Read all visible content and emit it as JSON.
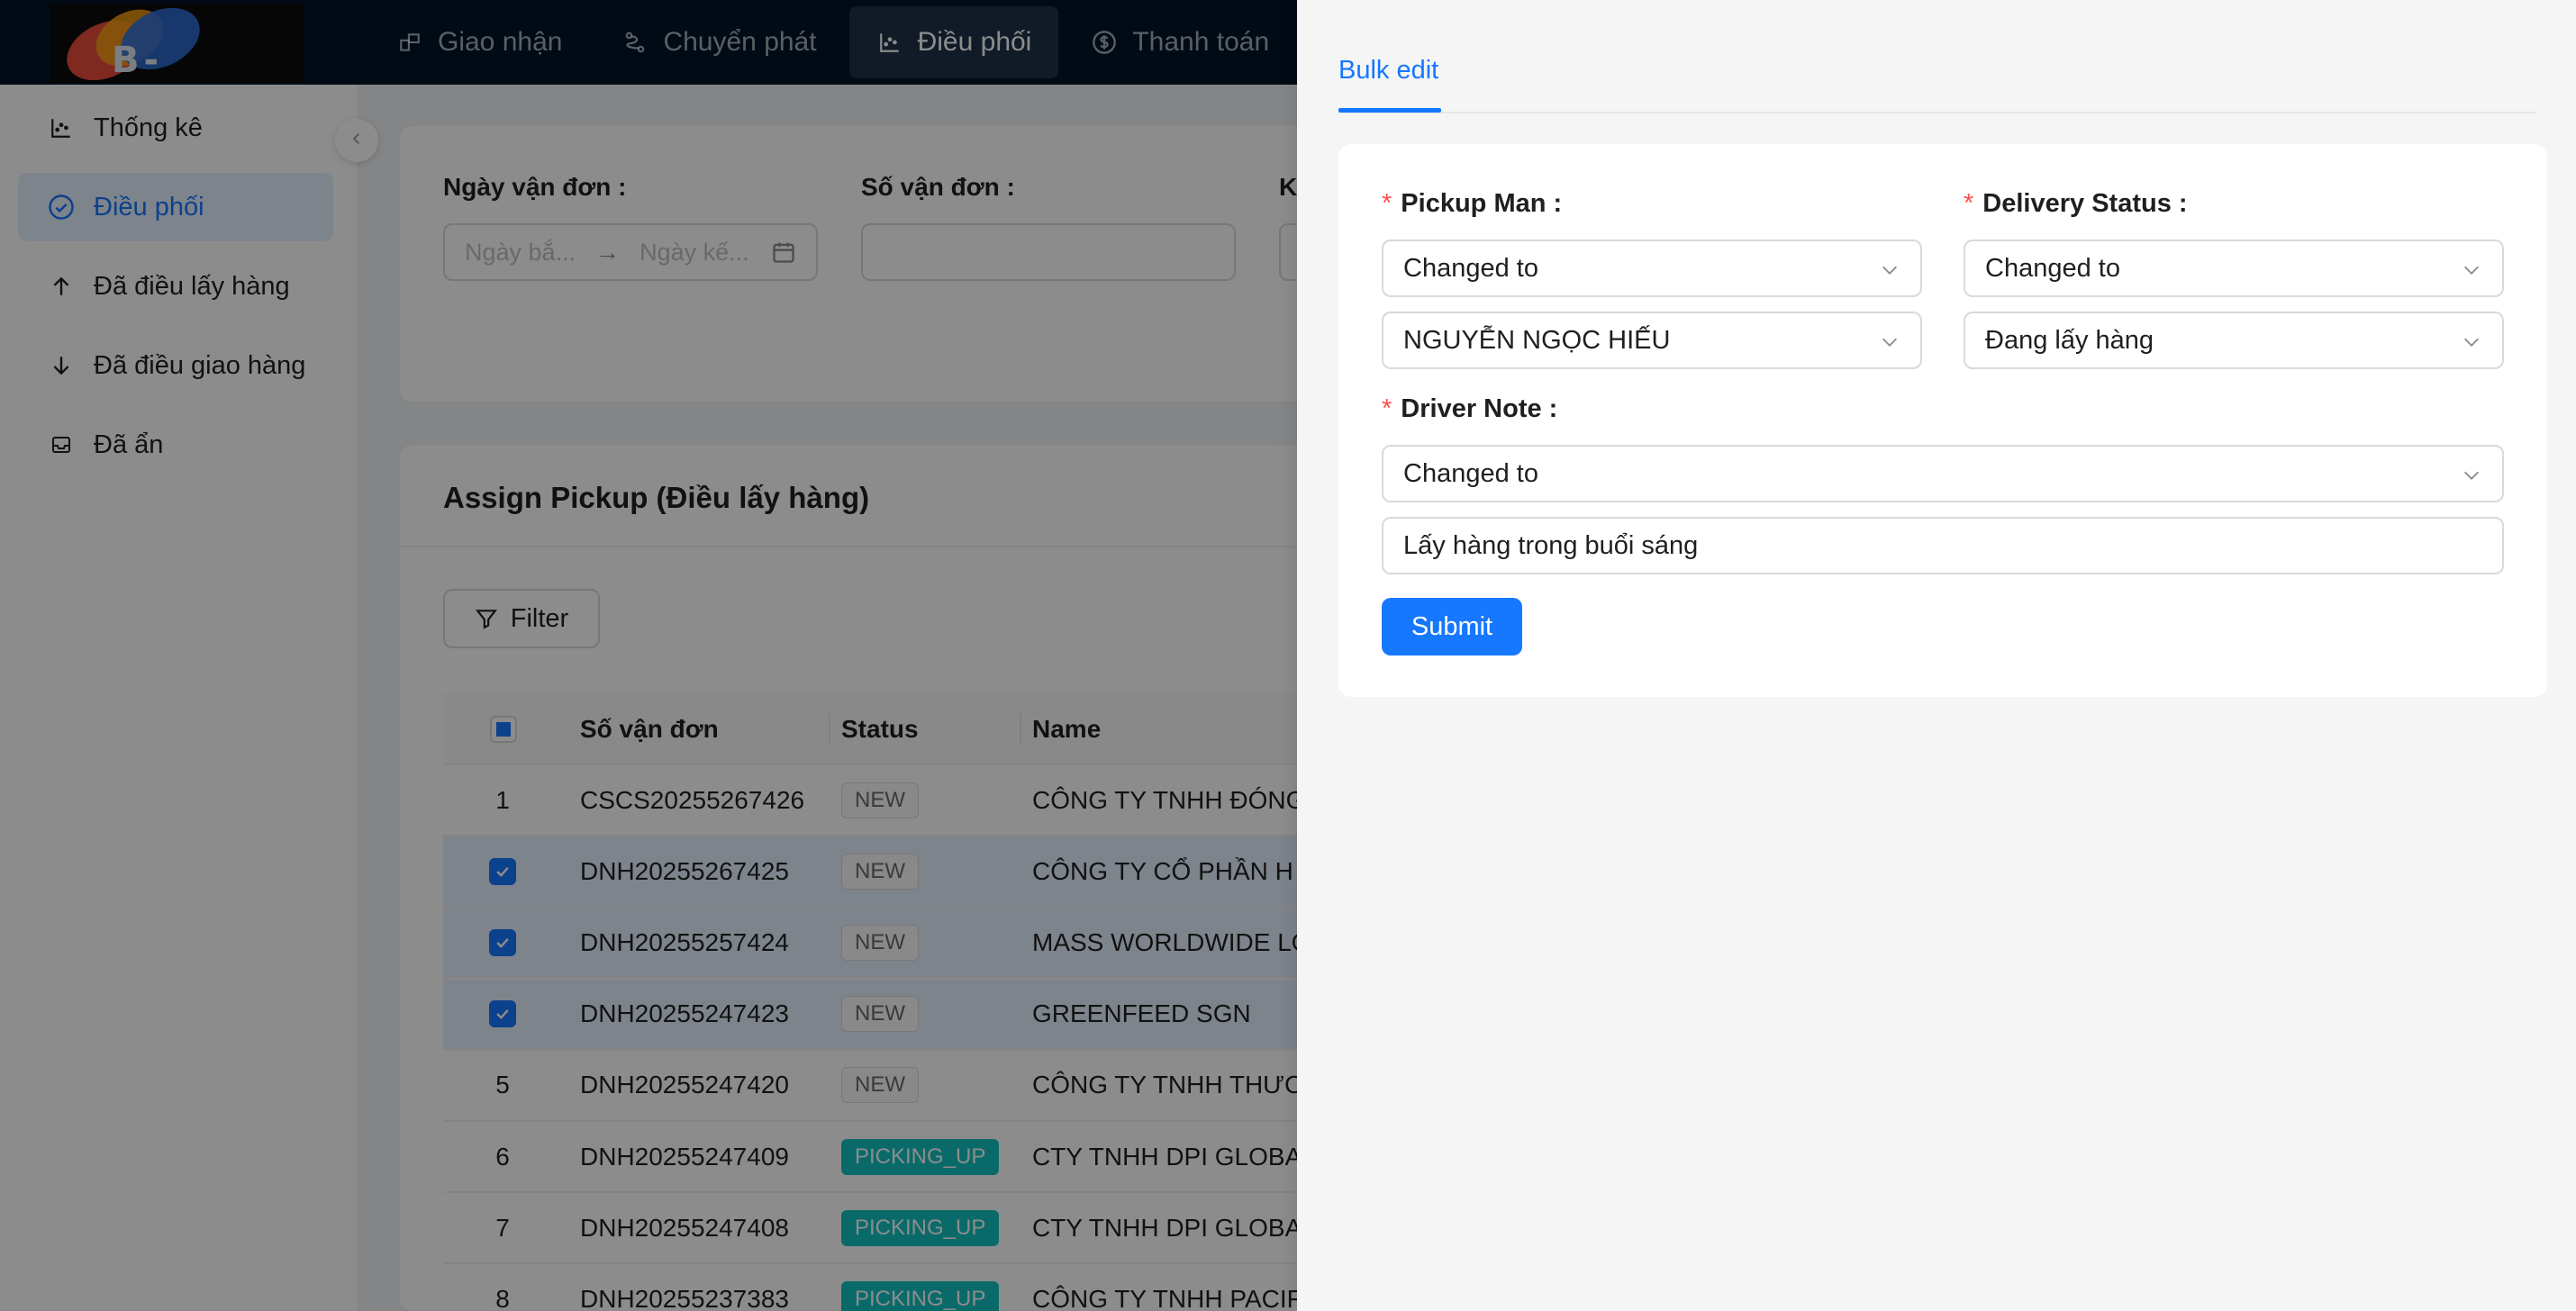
{
  "brand": {
    "logo_text": "B-LOGIS"
  },
  "topnav": {
    "items": [
      {
        "label": "Giao nhận",
        "icon": "box-icon"
      },
      {
        "label": "Chuyển phát",
        "icon": "route-icon"
      },
      {
        "label": "Điều phối",
        "icon": "chart-icon",
        "active": true
      },
      {
        "label": "Thanh toán",
        "icon": "dollar-icon"
      }
    ]
  },
  "sidebar": {
    "items": [
      {
        "label": "Thống kê",
        "icon": "chart-icon"
      },
      {
        "label": "Điều phối",
        "icon": "check-circle-icon",
        "active": true
      },
      {
        "label": "Đã điều lấy hàng",
        "icon": "arrow-up-icon"
      },
      {
        "label": "Đã điều giao hàng",
        "icon": "arrow-down-icon"
      },
      {
        "label": "Đã ẩn",
        "icon": "inbox-icon"
      }
    ]
  },
  "filters": {
    "date_label": "Ngày vận đơn :",
    "date_start_placeholder": "Ngày bắ...",
    "date_end_placeholder": "Ngày kế...",
    "waybill_label": "Số vận đơn :",
    "third_label": "K"
  },
  "table": {
    "title": "Assign Pickup (Điều lấy hàng)",
    "filter_button": "Filter",
    "columns": [
      "Số vận đơn",
      "Status",
      "Name"
    ],
    "rows": [
      {
        "index": "1",
        "checked": false,
        "waybill": "CSCS20255267426",
        "status": "NEW",
        "name": "CÔNG TY TNHH ĐÓNG"
      },
      {
        "index": "",
        "checked": true,
        "waybill": "DNH20255267425",
        "status": "NEW",
        "name": "CÔNG TY CỔ PHẦN H"
      },
      {
        "index": "",
        "checked": true,
        "waybill": "DNH20255257424",
        "status": "NEW",
        "name": "MASS WORLDWIDE LO"
      },
      {
        "index": "",
        "checked": true,
        "waybill": "DNH20255247423",
        "status": "NEW",
        "name": "GREENFEED SGN"
      },
      {
        "index": "5",
        "checked": false,
        "waybill": "DNH20255247420",
        "status": "NEW",
        "name": "CÔNG TY TNHH THƯƠ"
      },
      {
        "index": "6",
        "checked": false,
        "waybill": "DNH20255247409",
        "status": "PICKING_UP",
        "name": "CTY TNHH DPI GLOBA"
      },
      {
        "index": "7",
        "checked": false,
        "waybill": "DNH20255247408",
        "status": "PICKING_UP",
        "name": "CTY TNHH DPI GLOBA"
      },
      {
        "index": "8",
        "checked": false,
        "waybill": "DNH20255237383",
        "status": "PICKING_UP",
        "name": "CÔNG TY TNHH PACIF"
      }
    ]
  },
  "drawer": {
    "tab": "Bulk edit",
    "pickup_man": {
      "label": "Pickup Man",
      "mode": "Changed to",
      "value": "NGUYỄN NGỌC HIẾU"
    },
    "delivery_status": {
      "label": "Delivery Status",
      "mode": "Changed to",
      "value": "Đang lấy hàng"
    },
    "driver_note": {
      "label": "Driver Note",
      "mode": "Changed to",
      "value": "Lấy hàng trong buổi sáng"
    },
    "submit": "Submit"
  },
  "colors": {
    "primary": "#1677ff",
    "header_bg": "#001529",
    "required": "#ff4d4f",
    "picking_up": "#13c2c2"
  }
}
